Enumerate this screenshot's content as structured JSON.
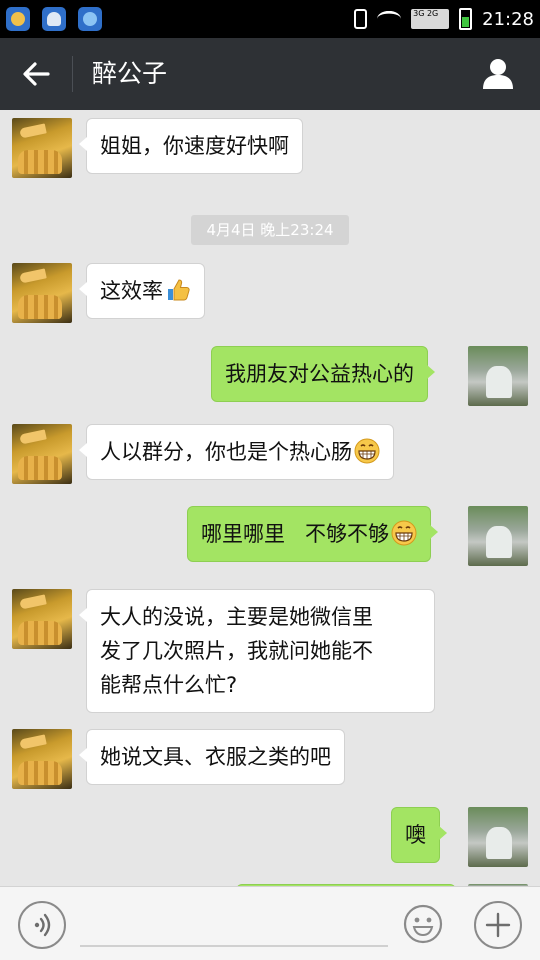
{
  "status_bar": {
    "time": "21:28",
    "network": "3G 2G",
    "icons": [
      "notification-app-icon",
      "weather-app-icon",
      "browser-app-icon",
      "phone-vibrate-icon",
      "wifi-icon",
      "signal-icon",
      "battery-icon"
    ]
  },
  "header": {
    "title": "醉公子",
    "back_icon": "back-arrow-icon",
    "profile_icon": "person-icon"
  },
  "chat": {
    "timestamp": "4月4日 晚上23:24",
    "messages": [
      {
        "side": "left",
        "text": "姐姐，你速度好快啊"
      },
      {
        "side": "left",
        "text": "这效率",
        "emoji": "thumbs-up-emoji"
      },
      {
        "side": "right",
        "text": "我朋友对公益热心的"
      },
      {
        "side": "left",
        "text": "人以群分，你也是个热心肠",
        "emoji": "grin-emoji"
      },
      {
        "side": "right",
        "text": "哪里哪里   不够不够",
        "emoji": "grin-emoji"
      },
      {
        "side": "left",
        "lines": [
          "大人的没说，主要是她微信里",
          "发了几次照片，我就问她能不",
          "能帮点什么忙?"
        ]
      },
      {
        "side": "left",
        "text": "她说文具、衣服之类的吧"
      },
      {
        "side": "right",
        "text": "噢"
      }
    ]
  },
  "input_bar": {
    "voice_icon": "voice-input-icon",
    "emoji_icon": "emoji-face-icon",
    "plus_icon": "plus-icon"
  },
  "colors": {
    "title_bar": "#2e3135",
    "chat_bg": "#e6e6e6",
    "bubble_right": "#a3e463",
    "bubble_left": "#ffffff"
  }
}
